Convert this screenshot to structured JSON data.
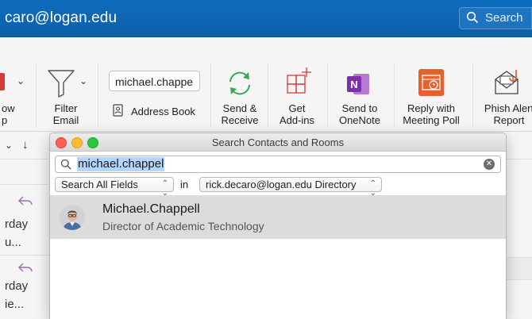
{
  "titlebar": {
    "account_partial": "caro@logan.edu",
    "search_placeholder": "Search"
  },
  "ribbon": {
    "partial_left_label": "ow\np",
    "filter_email": "Filter\nEmail",
    "address_input_value": "michael.chappe",
    "address_book": "Address Book",
    "send_receive": "Send &\nReceive",
    "get_addins": "Get\nAdd-ins",
    "send_onenote": "Send to\nOneNote",
    "reply_meeting_poll": "Reply with\nMeeting Poll",
    "phish_alert": "Phish Alert\nReport"
  },
  "leftpane": {
    "row1_day": "rday",
    "row1_snip": "u...",
    "row2_day": "rday",
    "row2_snip": "ie..."
  },
  "dialog": {
    "title": "Search Contacts and Rooms",
    "search_value": "michael.chappel",
    "field_selector": "Search All Fields",
    "in_label": "in",
    "directory_selector": "rick.decaro@logan.edu Directory",
    "results": [
      {
        "name": "Michael.Chappell",
        "title": "Director of Academic Technology"
      }
    ]
  },
  "colors": {
    "titlebar_blue": "#0f6cbd",
    "selection_highlight": "#b4d5fe",
    "onenote_purple": "#7b2fa8",
    "meeting_poll_orange": "#e8612c",
    "send_receive_green": "#3aa757",
    "addins_red": "#d83b3b"
  }
}
